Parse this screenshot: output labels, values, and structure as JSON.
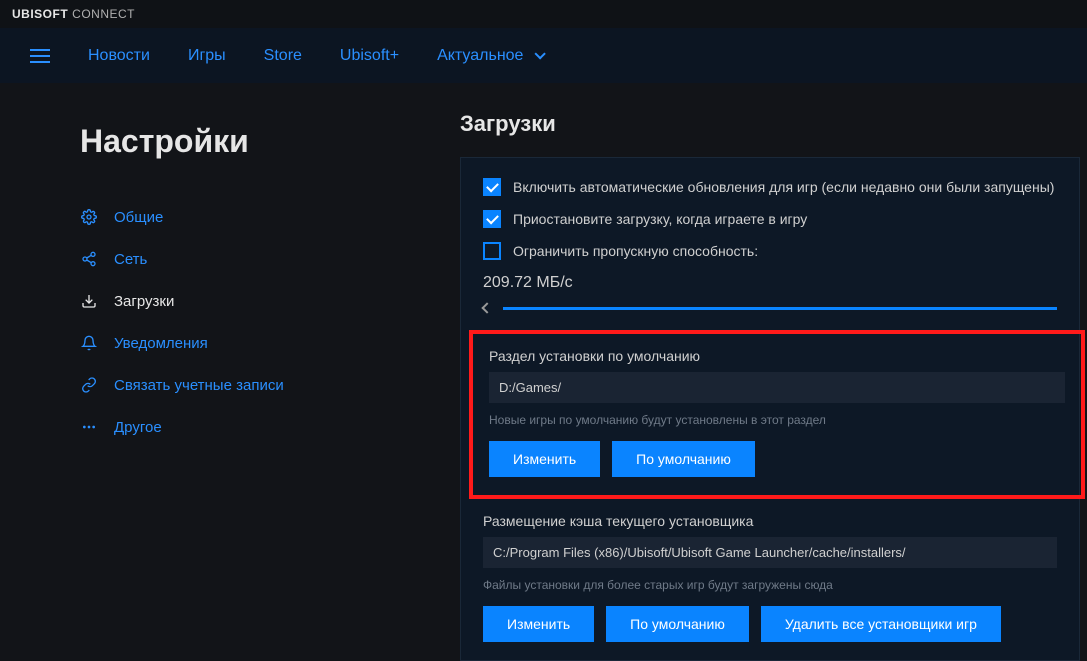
{
  "app": {
    "brand_bold": "UBISOFT",
    "brand_light": "CONNECT"
  },
  "nav": {
    "items": [
      "Новости",
      "Игры",
      "Store",
      "Ubisoft+",
      "Актуальное"
    ]
  },
  "sidebar": {
    "title": "Настройки",
    "items": [
      {
        "label": "Общие",
        "icon": "gear"
      },
      {
        "label": "Сеть",
        "icon": "share"
      },
      {
        "label": "Загрузки",
        "icon": "download",
        "active": true
      },
      {
        "label": "Уведомления",
        "icon": "bell"
      },
      {
        "label": "Связать учетные записи",
        "icon": "link"
      },
      {
        "label": "Другое",
        "icon": "dots"
      }
    ]
  },
  "main": {
    "heading": "Загрузки",
    "checks": [
      {
        "label": "Включить автоматические обновления для игр (если недавно они были запущены)",
        "checked": true
      },
      {
        "label": "Приостановите загрузку, когда играете в игру",
        "checked": true
      },
      {
        "label": "Ограничить пропускную способность:",
        "checked": false
      }
    ],
    "bandwidth": "209.72 МБ/с",
    "install_section": {
      "label": "Раздел установки по умолчанию",
      "path": "D:/Games/",
      "hint": "Новые игры по умолчанию будут установлены в этот раздел",
      "change": "Изменить",
      "default": "По умолчанию"
    },
    "cache_section": {
      "label": "Размещение кэша текущего установщика",
      "path": "C:/Program Files (x86)/Ubisoft/Ubisoft Game Launcher/cache/installers/",
      "hint": "Файлы установки для более старых игр будут загружены сюда",
      "change": "Изменить",
      "default": "По умолчанию",
      "delete": "Удалить все установщики игр"
    }
  }
}
